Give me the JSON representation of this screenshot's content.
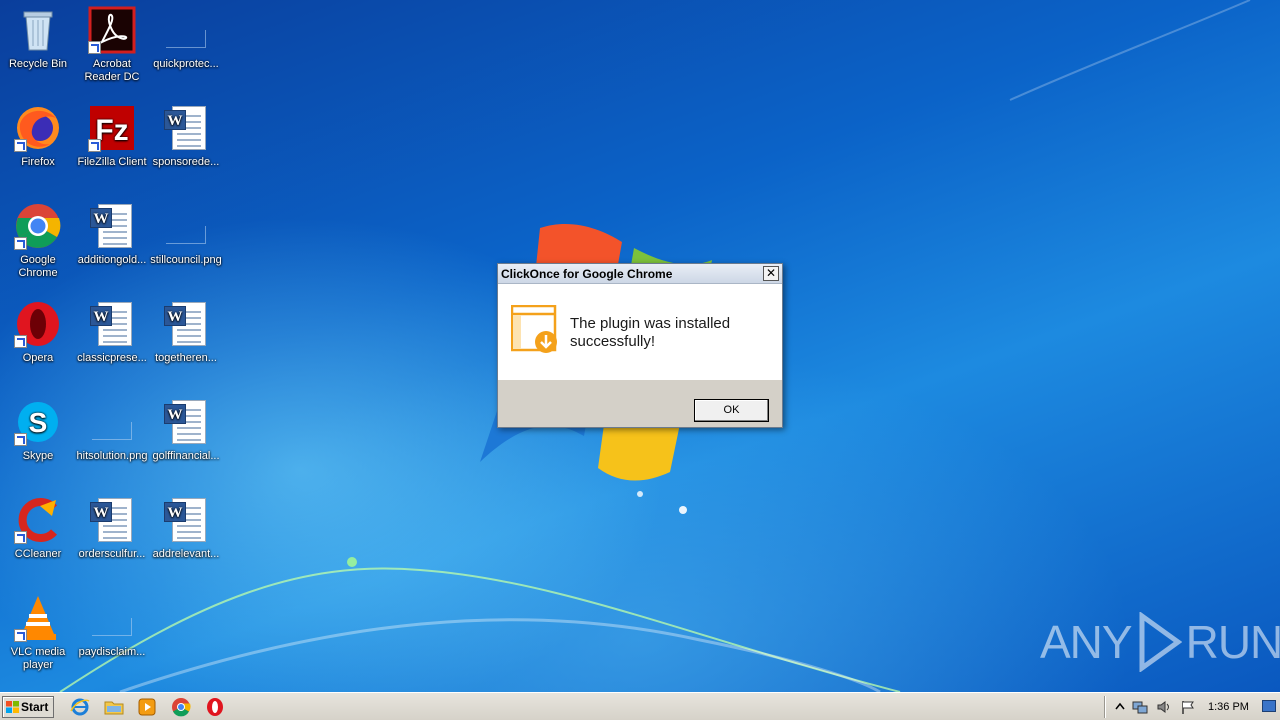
{
  "desktop": {
    "icons": [
      {
        "label": "Recycle Bin",
        "icon": "recycle-bin-icon"
      },
      {
        "label": "Acrobat Reader DC",
        "icon": "acrobat-icon"
      },
      {
        "label": "quickprotec...",
        "icon": "blank-file-icon"
      },
      {
        "label": "Firefox",
        "icon": "firefox-icon"
      },
      {
        "label": "FileZilla Client",
        "icon": "filezilla-icon"
      },
      {
        "label": "sponsorede...",
        "icon": "word-document-icon"
      },
      {
        "label": "Google Chrome",
        "icon": "chrome-icon"
      },
      {
        "label": "additiongold...",
        "icon": "word-document-icon"
      },
      {
        "label": "stillcouncil.png",
        "icon": "png-file-icon"
      },
      {
        "label": "Opera",
        "icon": "opera-icon"
      },
      {
        "label": "classicprese...",
        "icon": "word-document-icon"
      },
      {
        "label": "togetheren...",
        "icon": "word-document-icon"
      },
      {
        "label": "Skype",
        "icon": "skype-icon"
      },
      {
        "label": "hitsolution.png",
        "icon": "png-file-icon"
      },
      {
        "label": "golffinancial...",
        "icon": "word-document-icon"
      },
      {
        "label": "CCleaner",
        "icon": "ccleaner-icon"
      },
      {
        "label": "ordersculfur...",
        "icon": "word-document-icon"
      },
      {
        "label": "addrelevant...",
        "icon": "word-document-icon"
      },
      {
        "label": "VLC media player",
        "icon": "vlc-icon"
      },
      {
        "label": "paydisclaim...",
        "icon": "blank-file-icon"
      }
    ]
  },
  "dialog": {
    "title": "ClickOnce for Google Chrome",
    "close_glyph": "✕",
    "message": "The plugin was installed successfully!",
    "ok_label": "OK",
    "icon": "plugin-download-icon"
  },
  "watermark": {
    "left": "ANY",
    "right": "RUN"
  },
  "taskbar": {
    "start_label": "Start",
    "apps": [
      "internet-explorer-icon",
      "file-explorer-icon",
      "media-player-icon",
      "chrome-icon",
      "opera-icon"
    ],
    "tray": [
      "show-hidden-icons-icon",
      "network-icon",
      "volume-icon",
      "action-center-flag-icon"
    ],
    "clock": "1:36 PM"
  }
}
